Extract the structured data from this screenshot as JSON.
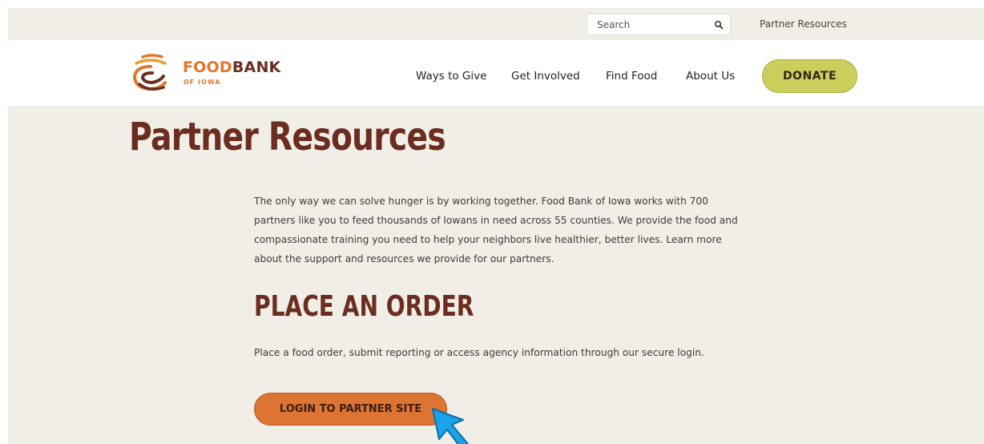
{
  "utility": {
    "search_placeholder": "Search",
    "search_icon": "search-icon",
    "partner_resources_link": "Partner Resources"
  },
  "brand": {
    "name_part1": "FOOD",
    "name_part2": "BANK",
    "sub": "OF IOWA",
    "logo_icon": "food-bank-logo-icon"
  },
  "nav": {
    "items": [
      "Ways to Give",
      "Get Involved",
      "Find Food",
      "About Us"
    ],
    "donate_label": "DONATE"
  },
  "content": {
    "title": "Partner Resources",
    "intro": "The only way we can solve hunger is by working together. Food Bank of Iowa works with 700 partners like you to feed thousands of Iowans in need across 55 counties. We provide the food and compassionate training you need to help your neighbors live healthier, better lives. Learn more about the support and resources we provide for our partners.",
    "order_heading": "PLACE AN ORDER",
    "order_text": "Place a food order, submit reporting or access agency information through our secure login.",
    "login_label": "LOGIN TO PARTNER SITE"
  },
  "colors": {
    "accent_brown": "#6b2d1f",
    "accent_orange": "#de7434",
    "donate_green": "#c9cf5a",
    "background": "#f1eee7",
    "cursor_blue": "#1aa3e8"
  }
}
